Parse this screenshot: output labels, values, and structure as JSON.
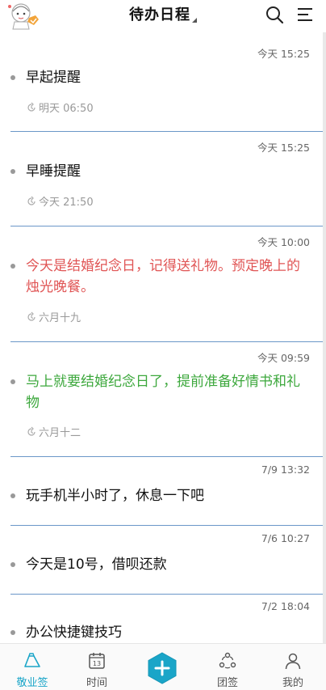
{
  "header": {
    "title": "待办日程",
    "search_icon": "search-icon",
    "menu_icon": "menu-lines-icon",
    "avatar_icon": "cartoon-avatar-with-check-badge"
  },
  "items": [
    {
      "time": "今天 15:25",
      "text": "早起提醒",
      "remind": "明天 06:50",
      "color": "#111111"
    },
    {
      "time": "今天 15:25",
      "text": "早睡提醒",
      "remind": "今天 21:50",
      "color": "#111111"
    },
    {
      "time": "今天 10:00",
      "text": "今天是结婚纪念日，记得送礼物。预定晚上的烛光晚餐。",
      "remind": "六月十九",
      "color": "#e05555"
    },
    {
      "time": "今天 09:59",
      "text": "马上就要结婚纪念日了，提前准备好情书和礼物",
      "remind": "六月十二",
      "color": "#3da83d"
    },
    {
      "time": "7/9 13:32",
      "text": "玩手机半小时了，休息一下吧"
    },
    {
      "time": "7/6 10:27",
      "text": "今天是10号，借呗还款"
    },
    {
      "time": "7/2 18:04",
      "text": "办公快捷键技巧"
    }
  ],
  "tabs": [
    {
      "label": "敬业签",
      "icon": "memo-icon",
      "active": true
    },
    {
      "label": "时间",
      "icon": "calendar-icon",
      "active": false
    },
    {
      "label": "",
      "icon": "plus-icon",
      "active": false
    },
    {
      "label": "团签",
      "icon": "team-icon",
      "active": false
    },
    {
      "label": "我的",
      "icon": "person-icon",
      "active": false
    }
  ],
  "colors": {
    "accent": "#1aa5c8",
    "separator": "#6b97c8",
    "red_note": "#e05555",
    "green_note": "#3da83d"
  }
}
